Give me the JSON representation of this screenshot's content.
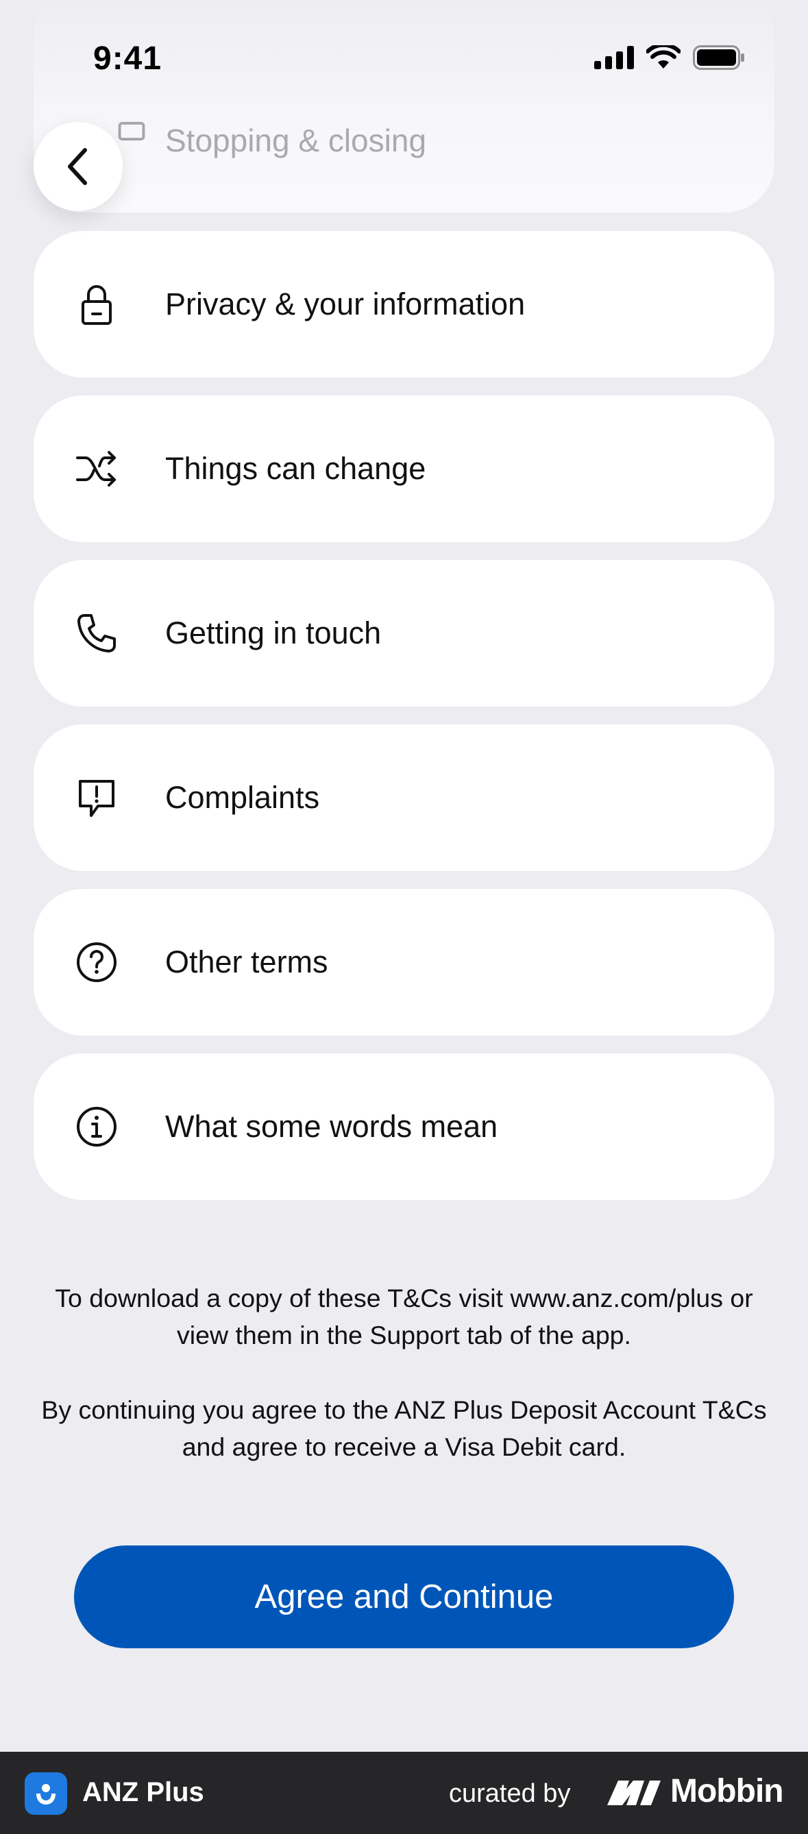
{
  "status_bar": {
    "time": "9:41"
  },
  "nav": {
    "back_icon": "chevron-left-icon"
  },
  "faded_item": {
    "label": "Stopping & closing",
    "icon": "card-stop-icon"
  },
  "sections": [
    {
      "label": "Privacy & your information",
      "icon": "lock-icon"
    },
    {
      "label": "Things can change",
      "icon": "shuffle-icon"
    },
    {
      "label": "Getting in touch",
      "icon": "phone-icon"
    },
    {
      "label": "Complaints",
      "icon": "alert-message-icon"
    },
    {
      "label": "Other terms",
      "icon": "question-circle-icon"
    },
    {
      "label": "What some words mean",
      "icon": "info-circle-icon"
    }
  ],
  "notes": {
    "download": "To download a copy of these T&Cs visit www.anz.com/plus or view them in the Support tab of the app.",
    "agreement": "By continuing you agree to the ANZ Plus Deposit Account T&Cs and agree to receive a Visa Debit card."
  },
  "primary_action": {
    "label": "Agree and Continue"
  },
  "footer": {
    "app_name": "ANZ Plus",
    "curated_by": "curated by",
    "brand": "Mobbin"
  },
  "colors": {
    "background": "#ECECF1",
    "card": "#FFFFFF",
    "primary": "#0056B8",
    "footer_bg": "#262628",
    "app_icon": "#1F7AE0"
  }
}
